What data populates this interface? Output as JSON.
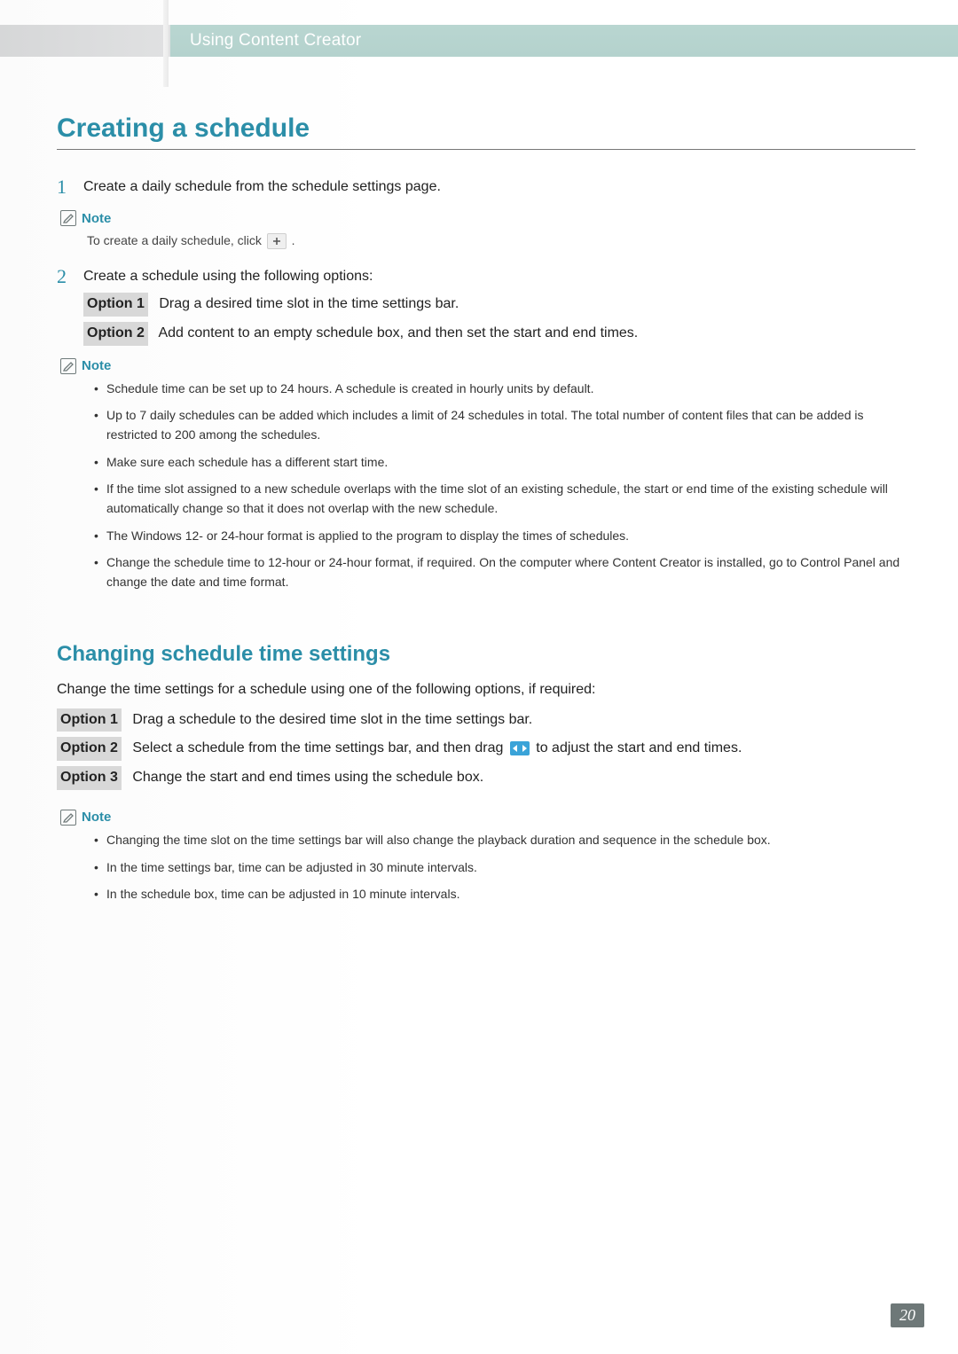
{
  "header": {
    "chapter_title": "Using Content Creator"
  },
  "section1": {
    "title": "Creating a schedule",
    "step1": {
      "num": "1",
      "text": "Create a daily schedule from the schedule settings page."
    },
    "note1": {
      "label": "Note",
      "text_before": "To create a daily schedule, click ",
      "text_after": " ."
    },
    "step2": {
      "num": "2",
      "intro": "Create a schedule using the following options:",
      "option1_tag": "Option 1",
      "option1_text": "Drag a desired time slot in the time settings bar.",
      "option2_tag": "Option 2",
      "option2_text": "Add content to an empty schedule box, and then set the start and end times."
    },
    "note2": {
      "label": "Note",
      "items": [
        "Schedule time can be set up to 24 hours. A schedule is created in hourly units by default.",
        "Up to 7 daily schedules can be added which includes a limit of 24 schedules in total. The total number of content files that can be added is restricted to 200 among the schedules.",
        "Make sure each schedule has a different start time.",
        "If the time slot assigned to a new schedule overlaps with the time slot of an existing schedule, the start or end time of the existing schedule will automatically change so that it does not overlap with the new schedule.",
        "The Windows 12- or 24-hour format is applied to the program to display the times of schedules.",
        "Change the schedule time to 12-hour or 24-hour format, if required. On the computer where Content Creator is installed, go to Control Panel and change the date and time format."
      ]
    }
  },
  "section2": {
    "title": "Changing schedule time settings",
    "intro": "Change the time settings for a schedule using one of the following options, if required:",
    "option1_tag": "Option 1",
    "option1_text": "Drag a schedule to the desired time slot in the time settings bar.",
    "option2_tag": "Option 2",
    "option2_text_before": "Select a schedule from the time settings bar, and then drag ",
    "option2_text_after": " to adjust the start and end times.",
    "option3_tag": "Option 3",
    "option3_text": "Change the start and end times using the schedule box.",
    "note3": {
      "label": "Note",
      "items": [
        "Changing the time slot on the time settings bar will also change the playback duration and sequence in the schedule box.",
        "In the time settings bar, time can be adjusted in 30 minute intervals.",
        "In the schedule box, time can be adjusted in 10 minute intervals."
      ]
    }
  },
  "page_number": "20"
}
